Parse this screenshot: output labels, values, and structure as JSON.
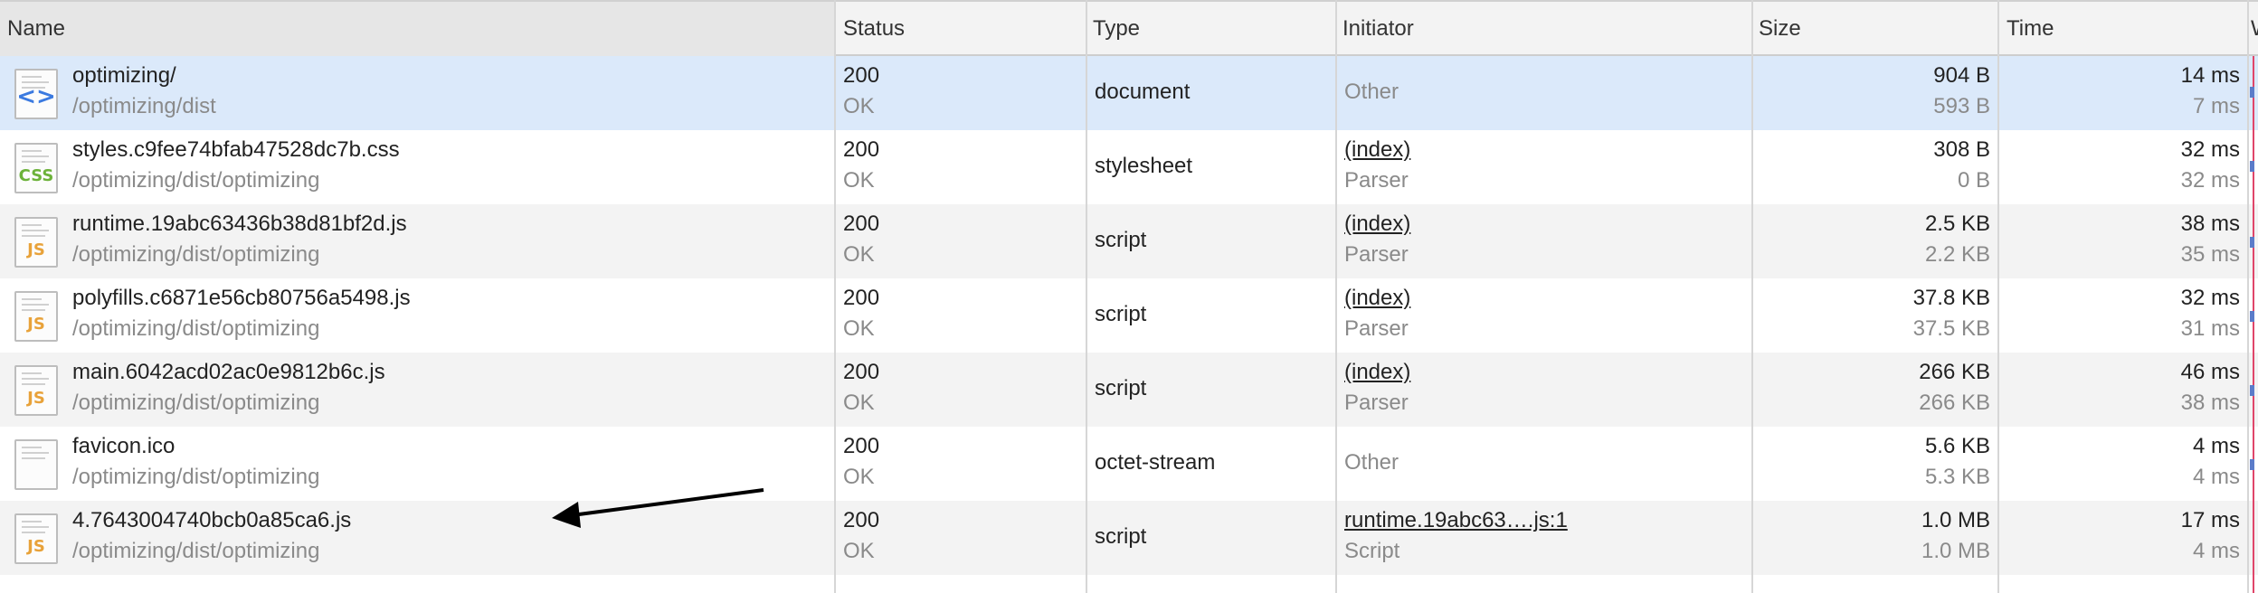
{
  "columns": {
    "name": "Name",
    "status": "Status",
    "type": "Type",
    "initiator": "Initiator",
    "size": "Size",
    "time": "Time",
    "waterfall": "W"
  },
  "rows": [
    {
      "name": "optimizing/",
      "path": "/optimizing/dist",
      "status_code": "200",
      "status_text": "OK",
      "type": "document",
      "initiator": "",
      "initiator_sub": "Other",
      "size": "904 B",
      "size_sub": "593 B",
      "time": "14 ms",
      "time_sub": "7 ms",
      "icon": "html-document-icon",
      "icon_label": "<>"
    },
    {
      "name": "styles.c9fee74bfab47528dc7b.css",
      "path": "/optimizing/dist/optimizing",
      "status_code": "200",
      "status_text": "OK",
      "type": "stylesheet",
      "initiator": "(index)",
      "initiator_sub": "Parser",
      "size": "308 B",
      "size_sub": "0 B",
      "time": "32 ms",
      "time_sub": "32 ms",
      "icon": "css-file-icon",
      "icon_label": "CSS"
    },
    {
      "name": "runtime.19abc63436b38d81bf2d.js",
      "path": "/optimizing/dist/optimizing",
      "status_code": "200",
      "status_text": "OK",
      "type": "script",
      "initiator": "(index)",
      "initiator_sub": "Parser",
      "size": "2.5 KB",
      "size_sub": "2.2 KB",
      "time": "38 ms",
      "time_sub": "35 ms",
      "icon": "js-file-icon",
      "icon_label": "JS"
    },
    {
      "name": "polyfills.c6871e56cb80756a5498.js",
      "path": "/optimizing/dist/optimizing",
      "status_code": "200",
      "status_text": "OK",
      "type": "script",
      "initiator": "(index)",
      "initiator_sub": "Parser",
      "size": "37.8 KB",
      "size_sub": "37.5 KB",
      "time": "32 ms",
      "time_sub": "31 ms",
      "icon": "js-file-icon",
      "icon_label": "JS"
    },
    {
      "name": "main.6042acd02ac0e9812b6c.js",
      "path": "/optimizing/dist/optimizing",
      "status_code": "200",
      "status_text": "OK",
      "type": "script",
      "initiator": "(index)",
      "initiator_sub": "Parser",
      "size": "266 KB",
      "size_sub": "266 KB",
      "time": "46 ms",
      "time_sub": "38 ms",
      "icon": "js-file-icon",
      "icon_label": "JS"
    },
    {
      "name": "favicon.ico",
      "path": "/optimizing/dist/optimizing",
      "status_code": "200",
      "status_text": "OK",
      "type": "octet-stream",
      "initiator": "",
      "initiator_sub": "Other",
      "size": "5.6 KB",
      "size_sub": "5.3 KB",
      "time": "4 ms",
      "time_sub": "4 ms",
      "icon": "blank-file-icon",
      "icon_label": ""
    },
    {
      "name": "4.7643004740bcb0a85ca6.js",
      "path": "/optimizing/dist/optimizing",
      "status_code": "200",
      "status_text": "OK",
      "type": "script",
      "initiator": "runtime.19abc63….js:1",
      "initiator_sub": "Script",
      "size": "1.0 MB",
      "size_sub": "1.0 MB",
      "time": "17 ms",
      "time_sub": "4 ms",
      "icon": "js-file-icon",
      "icon_label": "JS"
    }
  ],
  "selected_row": 0,
  "colors": {
    "selected_row": "#dbe9fa",
    "stripe": "#f3f3f3",
    "js_icon": "#e8a23a",
    "css_icon": "#6cb23a",
    "html_icon": "#3b7ae0",
    "waterfall_marker": "#e0466a",
    "annotation_arrow": "#000000"
  }
}
